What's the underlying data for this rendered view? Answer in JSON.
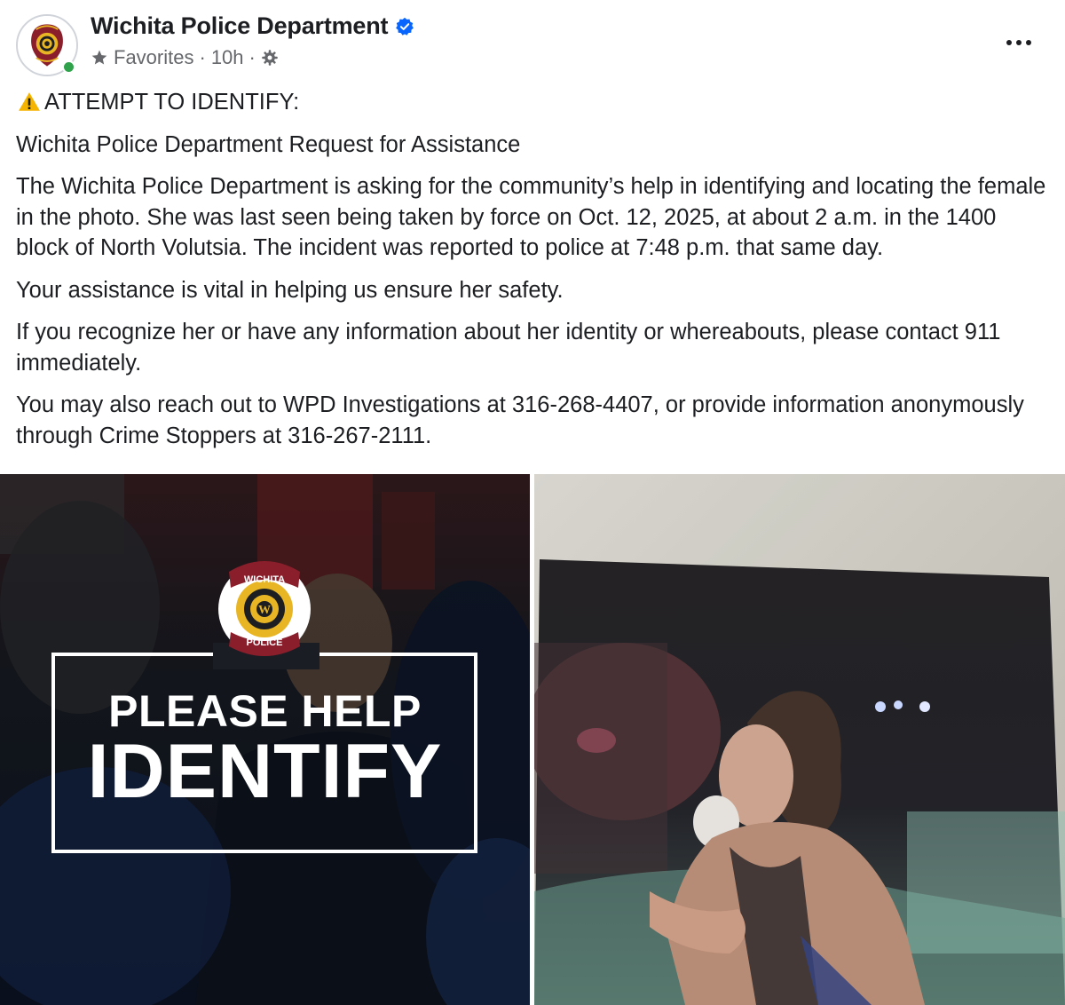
{
  "post": {
    "page_name": "Wichita Police Department",
    "meta": {
      "favorites_label": "Favorites",
      "separator": "·",
      "time": "10h",
      "separator2": "·"
    },
    "paragraphs": {
      "p1": "ATTEMPT TO IDENTIFY:",
      "p2": "Wichita Police Department Request for Assistance",
      "p3": "The Wichita Police Department is asking for the community’s help in identifying and locating the female in the photo. She was last seen being taken by force on Oct. 12, 2025, at about 2 a.m. in the 1400 block of North Volutsia. The incident was reported to police at 7:48 p.m. that same day.",
      "p4": "Your assistance is vital in helping us ensure her safety.",
      "p5": "If you recognize her or have any information about her identity or whereabouts, please contact 911 immediately.",
      "p6": "You may also reach out to WPD Investigations at 316-268-4407, or provide information anonymously through Crime Stoppers at 316-267-2111."
    },
    "media": {
      "left": {
        "badge_top": "WICHITA",
        "badge_bottom": "POLICE",
        "badge_center": "W",
        "line1": "PLEASE HELP",
        "line2": "IDENTIFY"
      }
    }
  },
  "icons": {
    "verified": "verified-badge-icon",
    "favorites": "star-icon",
    "audience": "gear-icon",
    "more": "more-options-icon",
    "warning": "warning-icon"
  },
  "colors": {
    "verified_blue": "#0866ff",
    "online_green": "#31a24c",
    "secondary_text": "#65676b",
    "badge_yellow": "#e8b524",
    "badge_red": "#8b1e2b"
  }
}
